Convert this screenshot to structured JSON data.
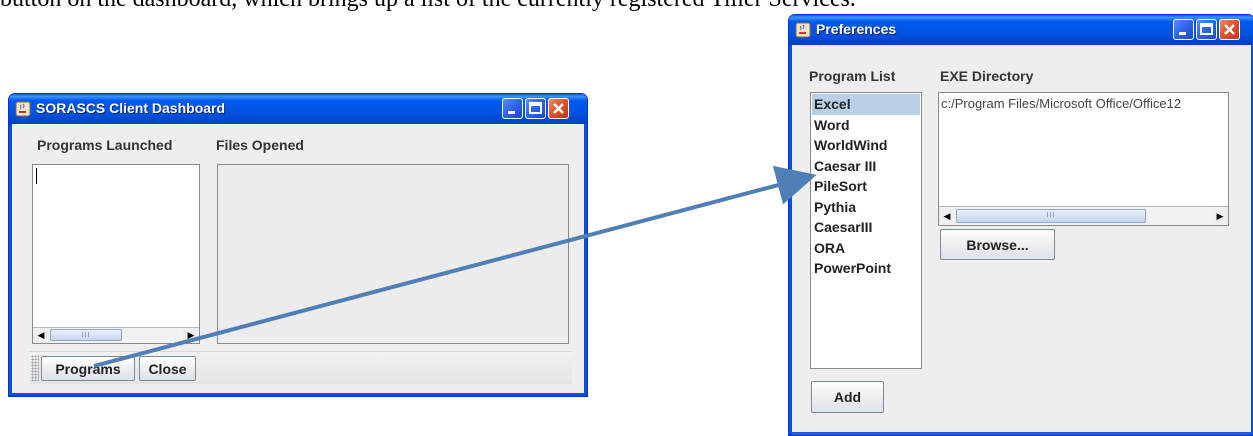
{
  "document": {
    "caption_fragment": "button on the dashboard, which brings up a list of the currently registered Tiller Services."
  },
  "dashboard": {
    "title": "SORASCS Client Dashboard",
    "programs_launched_label": "Programs Launched",
    "files_opened_label": "Files Opened",
    "programs_button": "Programs",
    "close_button": "Close",
    "scroll_thumb_grip": "III"
  },
  "preferences": {
    "title": "Preferences",
    "program_list_label": "Program List",
    "exe_directory_label": "EXE Directory",
    "programs": [
      "Excel",
      "Word",
      "WorldWind",
      "Caesar III",
      "PileSort",
      "Pythia",
      "CaesarIII",
      "ORA",
      "PowerPoint"
    ],
    "selected_program": "Excel",
    "exe_path": "c:/Program Files/Microsoft Office/Office12",
    "browse_button": "Browse...",
    "add_button": "Add",
    "scroll_thumb_grip": "III"
  },
  "colors": {
    "titlebar_blue": "#0054e3",
    "arrow": "#4f7fb6",
    "selection": "#b8cfe5"
  },
  "icons": {
    "app_icon": "java-cup-icon",
    "minimize": "minimize-icon",
    "maximize": "maximize-icon",
    "close": "close-icon"
  }
}
